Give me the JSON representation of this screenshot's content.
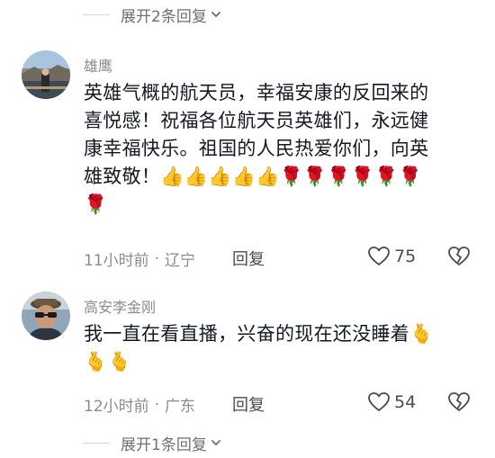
{
  "top_expand": {
    "label": "展开2条回复"
  },
  "comments": [
    {
      "username": "雄鹰",
      "text_line1": "英雄气概的航天员，幸福安康的反回来的",
      "text_line2": "喜悦感！祝福各位航天员英雄们，永远健",
      "text_line3": "康幸福快乐。祖国的人民热爱你们，向英",
      "text_line4": "雄致敬！",
      "time": "11小时前",
      "location": "辽宁",
      "reply_label": "回复",
      "likes": "75"
    },
    {
      "username": "高安李金刚",
      "text_line1": "我一直在看直播，兴奋的现在还没睡着",
      "time": "12小时前",
      "location": "广东",
      "reply_label": "回复",
      "likes": "54"
    }
  ],
  "bottom_expand": {
    "label": "展开1条回复"
  },
  "meta_separator": "·",
  "icons": {
    "thumbs_up": "👍",
    "rose": "🌹",
    "finger_heart": "🫰"
  },
  "colors": {
    "text_primary": "#161823",
    "text_secondary": "#8a8b91",
    "divider": "#d5d5d8"
  }
}
